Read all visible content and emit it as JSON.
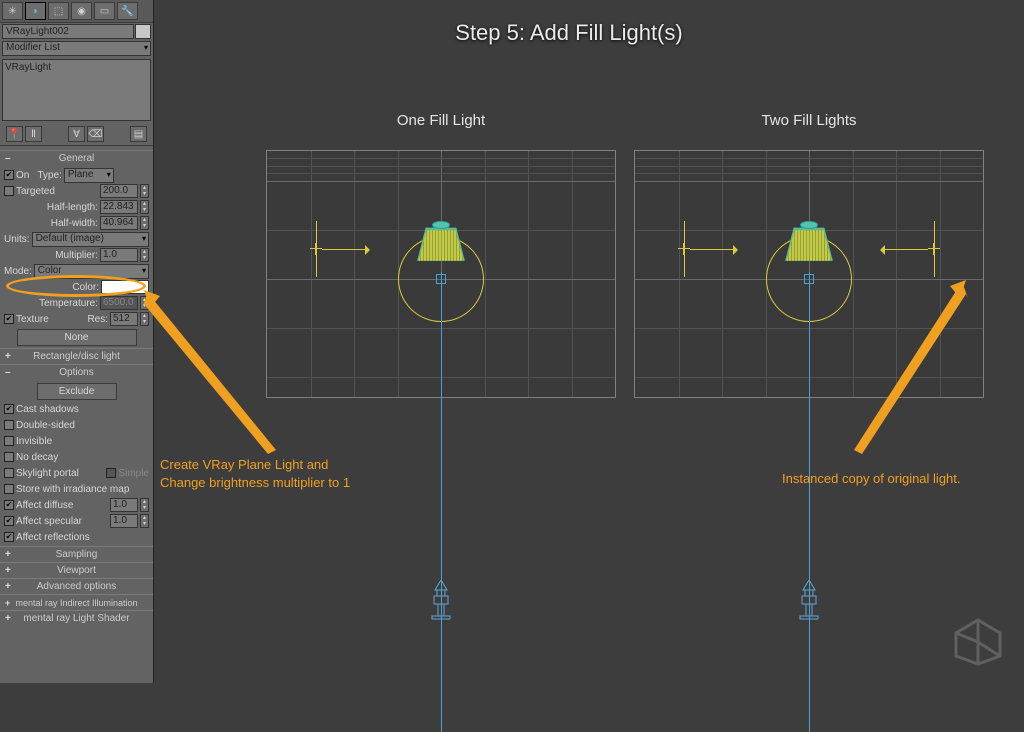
{
  "object_name": "VRayLight002",
  "modifier_list_label": "Modifier List",
  "stack_item": "VRayLight",
  "rollouts": {
    "general": {
      "title": "General",
      "on": {
        "label": "On",
        "checked": true
      },
      "type_label": "Type:",
      "type_value": "Plane",
      "targeted": {
        "label": "Targeted",
        "checked": false,
        "value": "200.0"
      },
      "half_length": {
        "label": "Half-length:",
        "value": "22.843"
      },
      "half_width": {
        "label": "Half-width:",
        "value": "40.964"
      },
      "units": {
        "label": "Units:",
        "value": "Default (image)"
      },
      "multiplier": {
        "label": "Multiplier:",
        "value": "1.0"
      },
      "mode": {
        "label": "Mode:",
        "value": "Color"
      },
      "color": {
        "label": "Color:"
      },
      "temperature": {
        "label": "Temperature:",
        "value": "6500.0"
      },
      "texture": {
        "label": "Texture",
        "checked": true,
        "res_label": "Res:",
        "res_value": "512"
      },
      "none_btn": "None"
    },
    "rect": {
      "title": "Rectangle/disc light"
    },
    "options": {
      "title": "Options",
      "exclude_btn": "Exclude",
      "cast_shadows": {
        "label": "Cast shadows",
        "checked": true
      },
      "double_sided": {
        "label": "Double-sided",
        "checked": false
      },
      "invisible": {
        "label": "Invisible",
        "checked": false
      },
      "no_decay": {
        "label": "No decay",
        "checked": false
      },
      "skylight_portal": {
        "label": "Skylight portal",
        "checked": false,
        "simple_label": "Simple",
        "simple_checked": false
      },
      "store_irradiance": {
        "label": "Store with irradiance map",
        "checked": false
      },
      "affect_diffuse": {
        "label": "Affect diffuse",
        "checked": true,
        "value": "1.0"
      },
      "affect_specular": {
        "label": "Affect specular",
        "checked": true,
        "value": "1.0"
      },
      "affect_reflections": {
        "label": "Affect reflections",
        "checked": true
      }
    },
    "sampling": {
      "title": "Sampling"
    },
    "viewport": {
      "title": "Viewport"
    },
    "advanced": {
      "title": "Advanced options"
    },
    "mr_indirect": {
      "title": "mental ray Indirect Illumination"
    },
    "mr_shader": {
      "title": "mental ray Light Shader"
    }
  },
  "main": {
    "step_title": "Step 5: Add Fill Light(s)",
    "vp1_label": "One Fill Light",
    "vp2_label": "Two Fill Lights"
  },
  "annotations": {
    "left": "Create VRay Plane Light and\nChange brightness multiplier to 1",
    "right": "Instanced copy of original light."
  }
}
